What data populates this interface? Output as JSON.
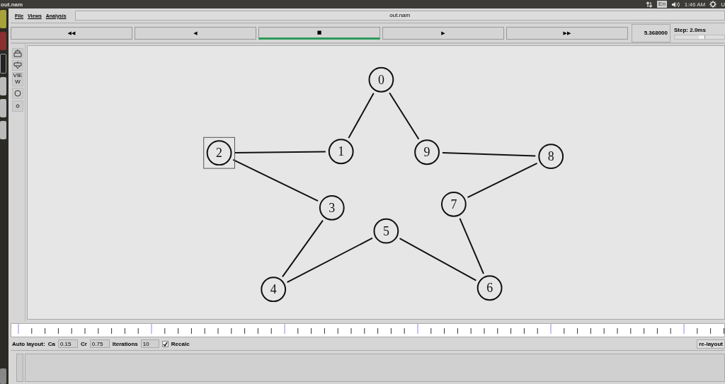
{
  "topbar": {
    "title": "out.nam",
    "keyboard": "En",
    "clock": "1:46 AM",
    "user": "U"
  },
  "menu": [
    "File",
    "Views",
    "Analysis"
  ],
  "title_field": {
    "value": "out.nam"
  },
  "transport": [
    {
      "label": "◀◀",
      "selected": false
    },
    {
      "label": "◀",
      "selected": false
    },
    {
      "label": "■",
      "selected": true
    },
    {
      "label": "▶",
      "selected": false
    },
    {
      "label": "▶▶",
      "selected": false
    }
  ],
  "time": "5.368000",
  "step": {
    "label": "Step: 2.0ms",
    "level": 0.6
  },
  "tools": {
    "view_label": "VIEW"
  },
  "nodes": [
    {
      "label": "0",
      "selected": false
    },
    {
      "label": "2",
      "selected": true
    },
    {
      "label": "1",
      "selected": false
    },
    {
      "label": "9",
      "selected": false
    },
    {
      "label": "8",
      "selected": false
    },
    {
      "label": "7",
      "selected": false
    },
    {
      "label": "3",
      "selected": false
    },
    {
      "label": "5",
      "selected": false
    },
    {
      "label": "4",
      "selected": false
    },
    {
      "label": "6",
      "selected": false
    }
  ],
  "auto_layout": {
    "label": "Auto layout:",
    "ca_label": "Ca",
    "ca": "0.15",
    "cr_label": "Cr",
    "cr": "0.75",
    "iterations_label": "Iterations",
    "iterations": "10",
    "recalc_label": "Recalc",
    "recalc_checked": true,
    "relayout": "re-layout"
  }
}
